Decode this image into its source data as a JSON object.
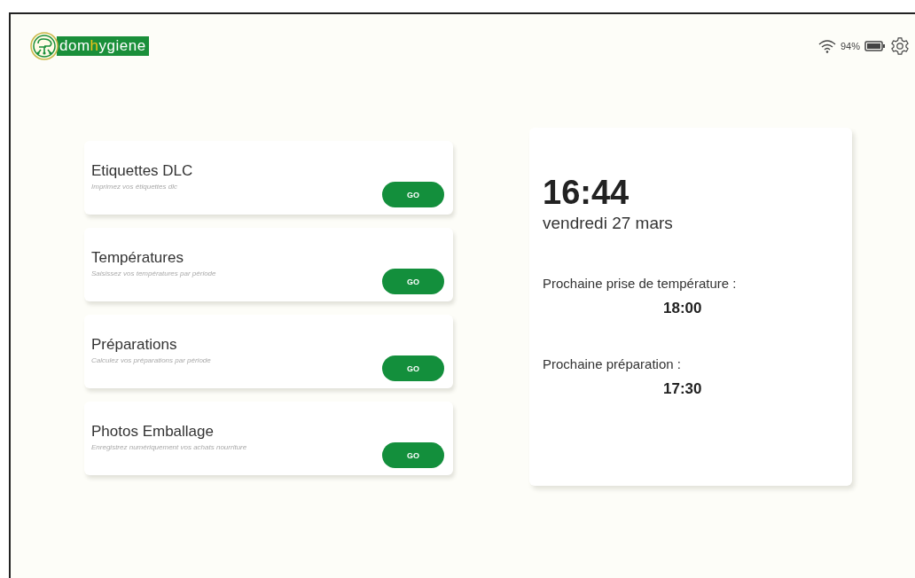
{
  "header": {
    "logo": [
      {
        "text": "dom",
        "kind": "plain"
      },
      {
        "text": "h",
        "kind": "accent"
      },
      {
        "text": "ygiene",
        "kind": "plain"
      }
    ],
    "battery_text": "94%"
  },
  "cards": [
    {
      "title": "Etiquettes DLC",
      "subtitle": "Imprimez vos étiquettes dlc",
      "button": "GO"
    },
    {
      "title": "Températures",
      "subtitle": "Saisissez vos températures par période",
      "button": "GO"
    },
    {
      "title": "Préparations",
      "subtitle": "Calculez vos préparations par période",
      "button": "GO"
    },
    {
      "title": "Photos Emballage",
      "subtitle": "Enregistrez numériquement vos achats nourriture",
      "button": "GO"
    }
  ],
  "info": {
    "time": "16:44",
    "date": "vendredi 27 mars",
    "events": [
      {
        "label": "Prochaine prise de température :",
        "time": "18:00"
      },
      {
        "label": "Prochaine préparation :",
        "time": "17:30"
      }
    ]
  }
}
